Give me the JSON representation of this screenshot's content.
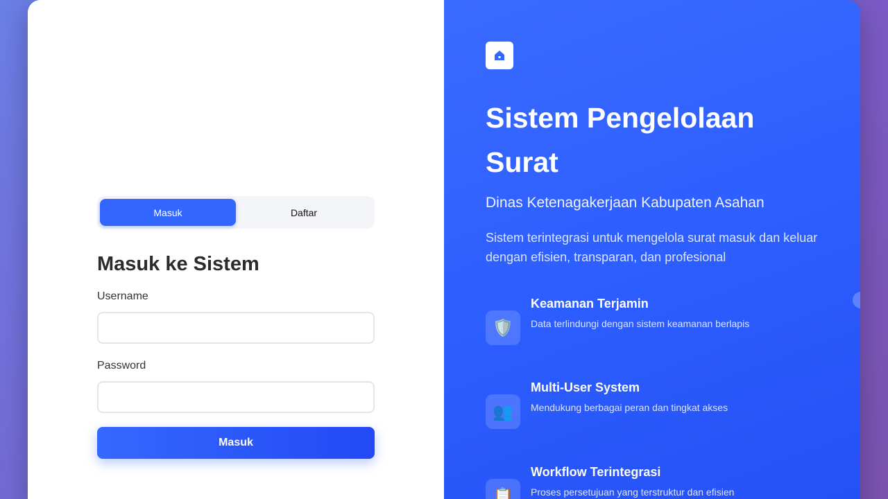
{
  "auth_tabs": {
    "login_label": "Masuk",
    "register_label": "Daftar"
  },
  "login_form": {
    "title": "Masuk ke Sistem",
    "username_label": "Username",
    "username_value": "",
    "password_label": "Password",
    "password_value": "",
    "submit_label": "Masuk"
  },
  "hero": {
    "logo_icon": "home-icon",
    "title": "Sistem Pengelolaan Surat",
    "subtitle": "Dinas Ketenagakerjaan Kabupaten Asahan",
    "description": "Sistem terintegrasi untuk mengelola surat masuk dan keluar dengan efisien, transparan, dan profesional"
  },
  "features": [
    {
      "icon": "shield-icon",
      "glyph": "🛡️",
      "title": "Keamanan Terjamin",
      "desc": "Data terlindungi dengan sistem keamanan berlapis"
    },
    {
      "icon": "users-icon",
      "glyph": "👥",
      "title": "Multi-User System",
      "desc": "Mendukung berbagai peran dan tingkat akses"
    },
    {
      "icon": "clipboard-icon",
      "glyph": "📋",
      "title": "Workflow Terintegrasi",
      "desc": "Proses persetujuan yang terstruktur dan efisien"
    }
  ],
  "colors": {
    "accent": "#3366ff",
    "panel_gradient_start": "#3a6bff",
    "panel_gradient_end": "#2450f5"
  }
}
